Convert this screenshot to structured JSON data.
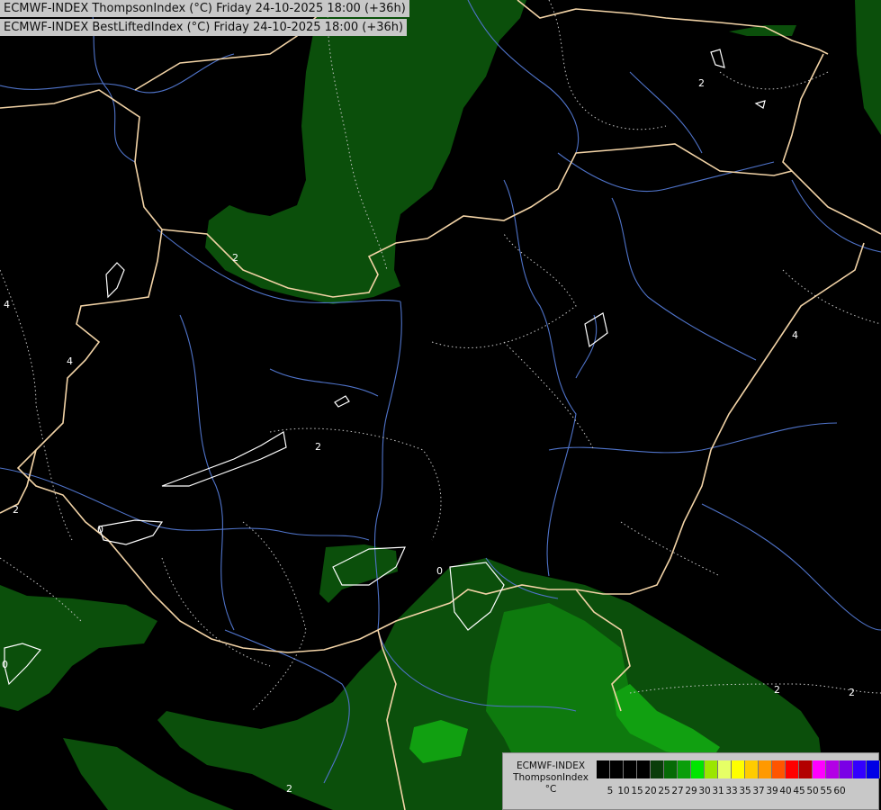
{
  "titles": {
    "line1": "ECMWF-INDEX ThompsonIndex (°C) Friday 24-10-2025 18:00 (+36h)",
    "line2": "ECMWF-INDEX BestLiftedIndex (°C) Friday 24-10-2025 18:00 (+36h)"
  },
  "legend": {
    "title_lines": [
      "ECMWF-INDEX",
      "ThompsonIndex",
      "°C"
    ],
    "colors": [
      "#000000",
      "#000000",
      "#000000",
      "#000000",
      "#0a3d0a",
      "#066b06",
      "#0a9e0a",
      "#00e600",
      "#9be600",
      "#e6ff66",
      "#ffff00",
      "#ffcc00",
      "#ff9900",
      "#ff5500",
      "#ff0000",
      "#b30000",
      "#ff00ff",
      "#b300e6",
      "#7a00e6",
      "#3300ff",
      "#0000e6"
    ],
    "ticks": [
      "5",
      "10",
      "15",
      "20",
      "25",
      "27",
      "29",
      "30",
      "31",
      "33",
      "35",
      "37",
      "39",
      "40",
      "45",
      "50",
      "55",
      "60"
    ]
  },
  "contour_labels": [
    "2",
    "2",
    "2",
    "2",
    "2",
    "2",
    "2",
    "2",
    "4",
    "4",
    "4",
    "0",
    "0",
    "0"
  ],
  "map_colors": {
    "background": "#000000",
    "dark_green": "#0b4f0b",
    "mid_green": "#0e7a0e",
    "light_green": "#11a011",
    "border": "#f2d3a6",
    "river": "#4f73c9",
    "lake": "#ffffff",
    "contour": "#c8c8c8"
  }
}
